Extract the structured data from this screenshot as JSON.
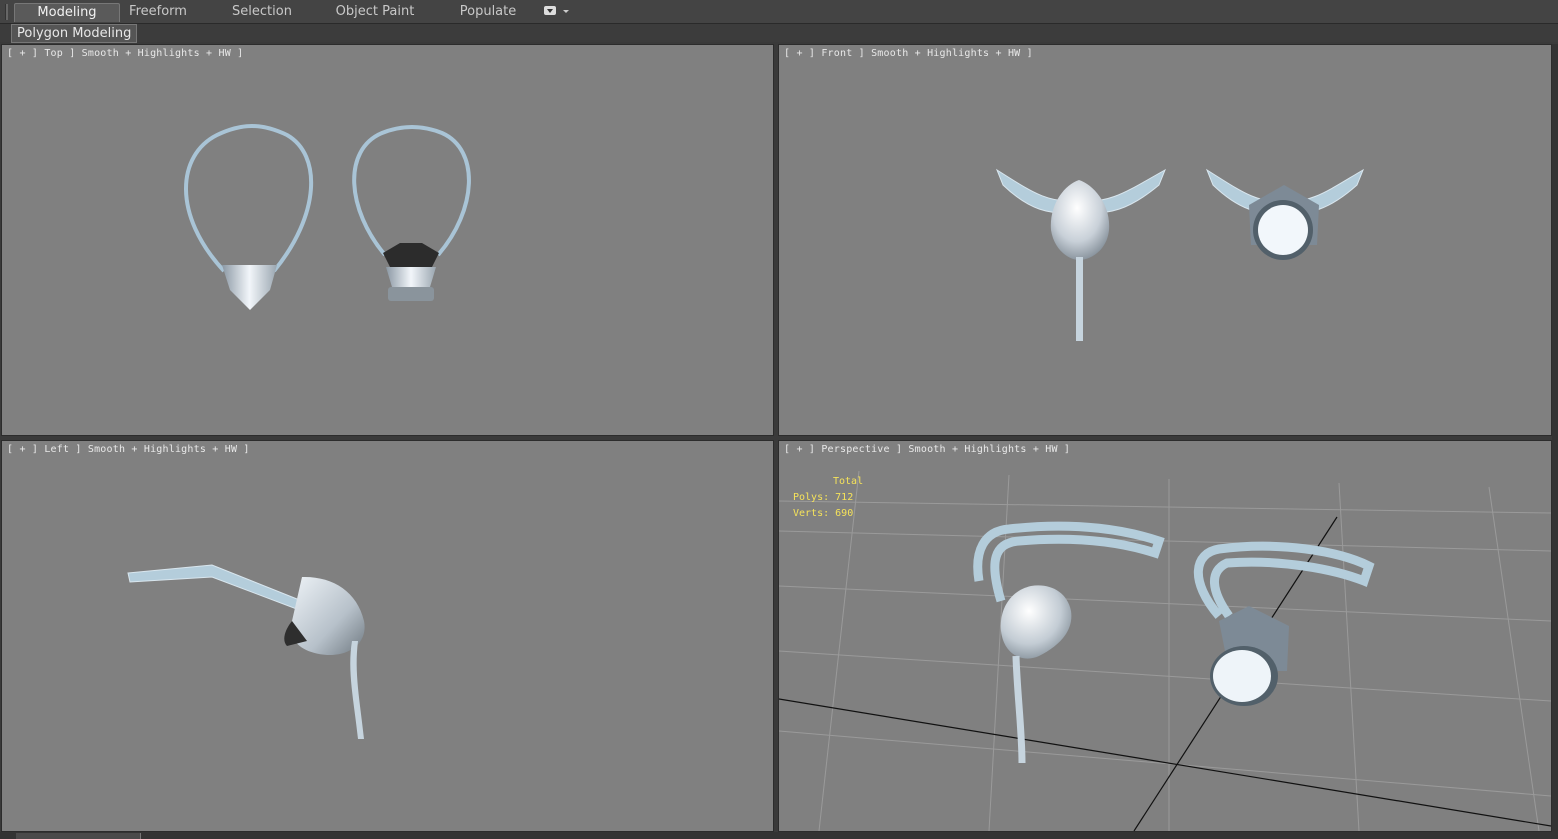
{
  "ribbon": {
    "tabs": [
      {
        "label": "Modeling",
        "active": true
      },
      {
        "label": "Freeform",
        "active": false
      },
      {
        "label": "Selection",
        "active": false
      },
      {
        "label": "Object Paint",
        "active": false
      },
      {
        "label": "Populate",
        "active": false
      }
    ],
    "options_icon": "ribbon-options-icon",
    "subtab": "Polygon Modeling"
  },
  "viewports": {
    "top": {
      "label": "[ + ] Top ] Smooth + Highlights + HW ]"
    },
    "front": {
      "label": "[ + ] Front ] Smooth + Highlights + HW ]"
    },
    "left": {
      "label": "[ + ] Left ] Smooth + Highlights + HW ]"
    },
    "perspective": {
      "label": "[ + ] Perspective ] Smooth + Highlights + HW ]",
      "stats": {
        "header": "Total",
        "polys_label": "Polys:",
        "polys_value": "712",
        "verts_label": "Verts:",
        "verts_value": "690"
      }
    }
  },
  "colors": {
    "viewport_bg": "#808080",
    "ui_bg": "#3a3a3a",
    "stats_text": "#f5e25a",
    "mask_silver": "#d6dde4",
    "strap_blue": "#a9c4d6"
  }
}
